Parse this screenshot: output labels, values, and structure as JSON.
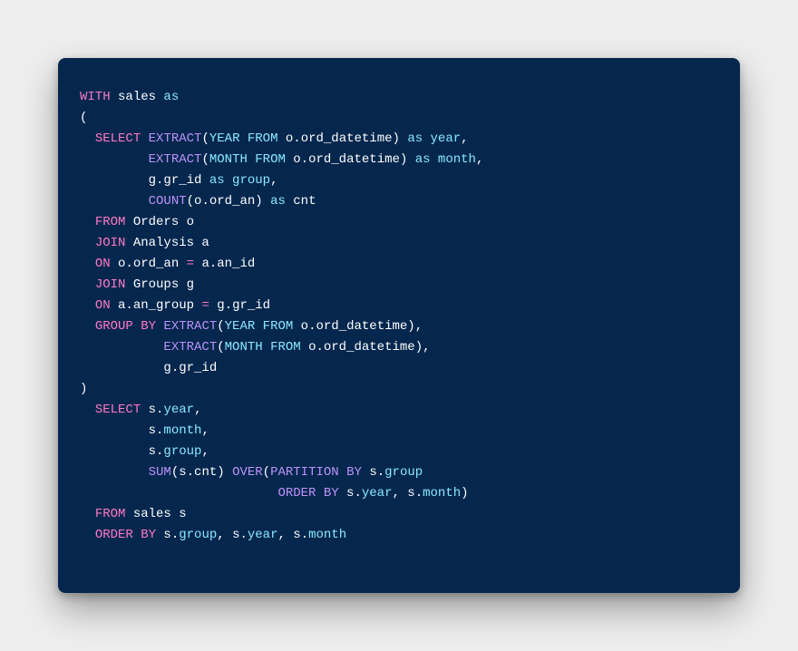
{
  "code": {
    "tokens": [
      [
        {
          "t": "WITH",
          "c": "kw1"
        },
        {
          "t": " sales ",
          "c": "def"
        },
        {
          "t": "as",
          "c": "as"
        }
      ],
      [
        {
          "t": "(",
          "c": "def"
        }
      ],
      [
        {
          "t": "  ",
          "c": "def"
        },
        {
          "t": "SELECT",
          "c": "kw1"
        },
        {
          "t": " ",
          "c": "def"
        },
        {
          "t": "EXTRACT",
          "c": "kw2"
        },
        {
          "t": "(",
          "c": "def"
        },
        {
          "t": "YEAR",
          "c": "kw3"
        },
        {
          "t": " ",
          "c": "def"
        },
        {
          "t": "FROM",
          "c": "kw3"
        },
        {
          "t": " o.ord_datetime) ",
          "c": "def"
        },
        {
          "t": "as",
          "c": "as"
        },
        {
          "t": " ",
          "c": "def"
        },
        {
          "t": "year",
          "c": "alias"
        },
        {
          "t": ",",
          "c": "def"
        }
      ],
      [
        {
          "t": "         ",
          "c": "def"
        },
        {
          "t": "EXTRACT",
          "c": "kw2"
        },
        {
          "t": "(",
          "c": "def"
        },
        {
          "t": "MONTH",
          "c": "kw3"
        },
        {
          "t": " ",
          "c": "def"
        },
        {
          "t": "FROM",
          "c": "kw3"
        },
        {
          "t": " o.ord_datetime) ",
          "c": "def"
        },
        {
          "t": "as",
          "c": "as"
        },
        {
          "t": " ",
          "c": "def"
        },
        {
          "t": "month",
          "c": "alias"
        },
        {
          "t": ",",
          "c": "def"
        }
      ],
      [
        {
          "t": "         g.gr_id ",
          "c": "def"
        },
        {
          "t": "as",
          "c": "as"
        },
        {
          "t": " ",
          "c": "def"
        },
        {
          "t": "group",
          "c": "alias"
        },
        {
          "t": ",",
          "c": "def"
        }
      ],
      [
        {
          "t": "         ",
          "c": "def"
        },
        {
          "t": "COUNT",
          "c": "kw2"
        },
        {
          "t": "(o.ord_an) ",
          "c": "def"
        },
        {
          "t": "as",
          "c": "as"
        },
        {
          "t": " cnt",
          "c": "def"
        }
      ],
      [
        {
          "t": "  ",
          "c": "def"
        },
        {
          "t": "FROM",
          "c": "kw1"
        },
        {
          "t": " Orders o",
          "c": "def"
        }
      ],
      [
        {
          "t": "  ",
          "c": "def"
        },
        {
          "t": "JOIN",
          "c": "kw1"
        },
        {
          "t": " Analysis a",
          "c": "def"
        }
      ],
      [
        {
          "t": "  ",
          "c": "def"
        },
        {
          "t": "ON",
          "c": "kw1"
        },
        {
          "t": " o.ord_an ",
          "c": "def"
        },
        {
          "t": "=",
          "c": "kw1"
        },
        {
          "t": " a.an_id",
          "c": "def"
        }
      ],
      [
        {
          "t": "  ",
          "c": "def"
        },
        {
          "t": "JOIN",
          "c": "kw1"
        },
        {
          "t": " Groups g",
          "c": "def"
        }
      ],
      [
        {
          "t": "  ",
          "c": "def"
        },
        {
          "t": "ON",
          "c": "kw1"
        },
        {
          "t": " a.an_group ",
          "c": "def"
        },
        {
          "t": "=",
          "c": "kw1"
        },
        {
          "t": " g.gr_id",
          "c": "def"
        }
      ],
      [
        {
          "t": "  ",
          "c": "def"
        },
        {
          "t": "GROUP BY",
          "c": "kw1"
        },
        {
          "t": " ",
          "c": "def"
        },
        {
          "t": "EXTRACT",
          "c": "kw2"
        },
        {
          "t": "(",
          "c": "def"
        },
        {
          "t": "YEAR",
          "c": "kw3"
        },
        {
          "t": " ",
          "c": "def"
        },
        {
          "t": "FROM",
          "c": "kw3"
        },
        {
          "t": " o.ord_datetime),",
          "c": "def"
        }
      ],
      [
        {
          "t": "           ",
          "c": "def"
        },
        {
          "t": "EXTRACT",
          "c": "kw2"
        },
        {
          "t": "(",
          "c": "def"
        },
        {
          "t": "MONTH",
          "c": "kw3"
        },
        {
          "t": " ",
          "c": "def"
        },
        {
          "t": "FROM",
          "c": "kw3"
        },
        {
          "t": " o.ord_datetime),",
          "c": "def"
        }
      ],
      [
        {
          "t": "           g.gr_id",
          "c": "def"
        }
      ],
      [
        {
          "t": ")",
          "c": "def"
        }
      ],
      [
        {
          "t": "  ",
          "c": "def"
        },
        {
          "t": "SELECT",
          "c": "kw1"
        },
        {
          "t": " s.",
          "c": "def"
        },
        {
          "t": "year",
          "c": "alias"
        },
        {
          "t": ",",
          "c": "def"
        }
      ],
      [
        {
          "t": "         s.",
          "c": "def"
        },
        {
          "t": "month",
          "c": "alias"
        },
        {
          "t": ",",
          "c": "def"
        }
      ],
      [
        {
          "t": "         s.",
          "c": "def"
        },
        {
          "t": "group",
          "c": "alias"
        },
        {
          "t": ",",
          "c": "def"
        }
      ],
      [
        {
          "t": "         ",
          "c": "def"
        },
        {
          "t": "SUM",
          "c": "kw2"
        },
        {
          "t": "(s.cnt) ",
          "c": "def"
        },
        {
          "t": "OVER",
          "c": "kw2"
        },
        {
          "t": "(",
          "c": "def"
        },
        {
          "t": "PARTITION",
          "c": "kw2"
        },
        {
          "t": " ",
          "c": "def"
        },
        {
          "t": "BY",
          "c": "kw2"
        },
        {
          "t": " s.",
          "c": "def"
        },
        {
          "t": "group",
          "c": "alias"
        }
      ],
      [
        {
          "t": "                          ",
          "c": "def"
        },
        {
          "t": "ORDER BY",
          "c": "kw2"
        },
        {
          "t": " s.",
          "c": "def"
        },
        {
          "t": "year",
          "c": "alias"
        },
        {
          "t": ", s.",
          "c": "def"
        },
        {
          "t": "month",
          "c": "alias"
        },
        {
          "t": ")",
          "c": "def"
        }
      ],
      [
        {
          "t": "  ",
          "c": "def"
        },
        {
          "t": "FROM",
          "c": "kw1"
        },
        {
          "t": " sales s",
          "c": "def"
        }
      ],
      [
        {
          "t": "  ",
          "c": "def"
        },
        {
          "t": "ORDER BY",
          "c": "kw1"
        },
        {
          "t": " s.",
          "c": "def"
        },
        {
          "t": "group",
          "c": "alias"
        },
        {
          "t": ", s.",
          "c": "def"
        },
        {
          "t": "year",
          "c": "alias"
        },
        {
          "t": ", s.",
          "c": "def"
        },
        {
          "t": "month",
          "c": "alias"
        }
      ]
    ]
  },
  "colors": {
    "background_page": "#eeeeee",
    "background_card": "#05274e",
    "text_default": "#ffffff",
    "keyword_magenta": "#ff79c6",
    "keyword_purple": "#bd93f9",
    "keyword_cyan": "#8be9fd"
  }
}
